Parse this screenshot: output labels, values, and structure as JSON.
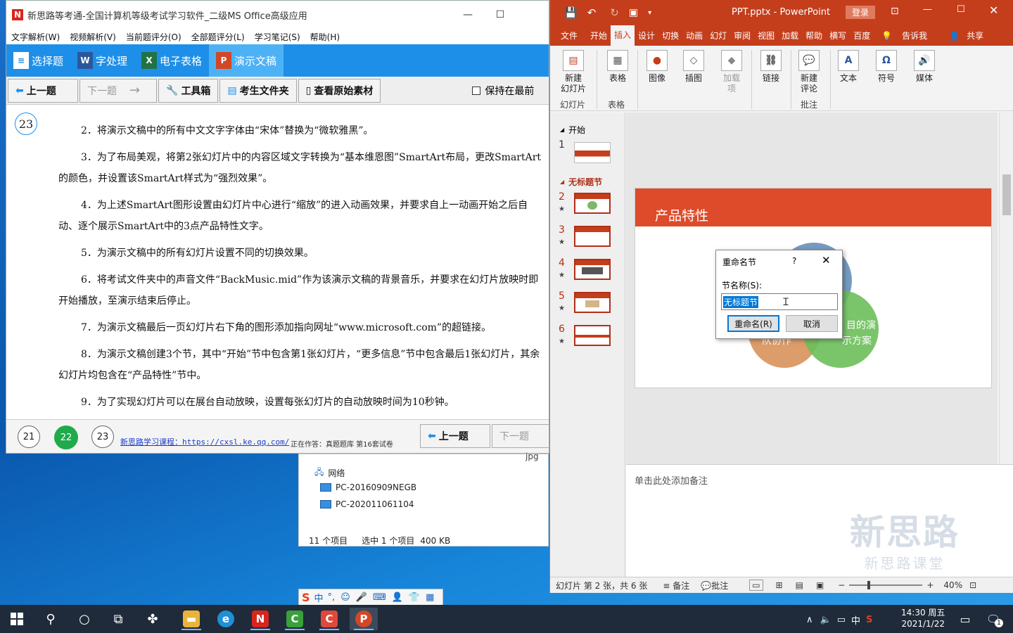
{
  "left_window": {
    "title": "新思路等考通-全国计算机等级考试学习软件_二级MS Office高级应用",
    "menu": [
      "文字解析(W)",
      "视频解析(V)",
      "当前题评分(O)",
      "全部题评分(L)",
      "学习笔记(S)",
      "帮助(H)"
    ],
    "subject_tabs": [
      "选择题",
      "字处理",
      "电子表格",
      "演示文稿"
    ],
    "toolbar": {
      "prev": "上一题",
      "next": "下一题",
      "toolbox": "工具箱",
      "folder": "考生文件夹",
      "original": "查看原始素材",
      "keep": "保持在最前"
    },
    "question_number": "23",
    "items": [
      "2．将演示文稿中的所有中文文字字体由“宋体”替换为“微软雅黑”。",
      "3．为了布局美观，将第2张幻灯片中的内容区域文字转换为“基本维恩图”SmartArt布局，更改SmartArt的颜色，并设置该SmartArt样式为“强烈效果”。",
      "4．为上述SmartArt图形设置由幻灯片中心进行“缩放”的进入动画效果，并要求自上一动画开始之后自动、逐个展示SmartArt中的3点产品特性文字。",
      "5．为演示文稿中的所有幻灯片设置不同的切换效果。",
      "6．将考试文件夹中的声音文件“BackMusic.mid”作为该演示文稿的背景音乐，并要求在幻灯片放映时即开始播放，至演示结束后停止。",
      "7．为演示文稿最后一页幻灯片右下角的图形添加指向网址“www.microsoft.com”的超链接。",
      "8．为演示文稿创建3个节，其中“开始”节中包含第1张幻灯片，“更多信息”节中包含最后1张幻灯片，其余幻灯片均包含在“产品特性”节中。",
      "9．为了实现幻灯片可以在展台自动放映，设置每张幻灯片的自动放映时间为10秒钟。"
    ],
    "footer": {
      "pages": [
        "21",
        "22",
        "23"
      ],
      "link": "新思路学习课程：https://cxsl.ke.qq.com/",
      "status": "正在作答：真题题库 第16套试卷",
      "prev": "上一题",
      "next": "下一题"
    }
  },
  "explorer": {
    "partial_label": "jpg",
    "tree": [
      "网络",
      "PC-20160909NEGB",
      "PC-202011061104"
    ],
    "status_count": "11 个项目",
    "status_selected": "选中 1 个项目",
    "status_size": "400 KB"
  },
  "ppt": {
    "filename": "PPT.pptx",
    "sep": "-",
    "app": "PowerPoint",
    "login": "登录",
    "tabs": [
      "文件",
      "开始",
      "插入",
      "设计",
      "切换",
      "动画",
      "幻灯",
      "审阅",
      "视图",
      "加载",
      "帮助",
      "横写",
      "百度"
    ],
    "tell_me": "告诉我",
    "share": "共享",
    "ribbon": {
      "new_slide": "新建\n幻灯片",
      "table": "表格",
      "image": "图像",
      "illustrations": "插图",
      "addins": "加载\n项",
      "link": "链接",
      "new_comment": "新建\n评论",
      "text": "文本",
      "symbol": "符号",
      "media": "媒体",
      "groups": [
        "幻灯片",
        "表格",
        "批注"
      ]
    },
    "sections": [
      "开始",
      "无标题节"
    ],
    "slide_numbers": [
      "1",
      "2",
      "3",
      "4",
      "5",
      "6"
    ],
    "star": "★",
    "slide_title": "产品特性",
    "venn_fragments": [
      "队协作",
      "目的演",
      "示方案"
    ],
    "notes_placeholder": "单击此处添加备注",
    "status": {
      "slide_info": "幻灯片 第 2 张，共 6 张",
      "notes": "备注",
      "comments": "批注",
      "zoom": "40%"
    },
    "watermark": [
      "新思路",
      "新思路课堂"
    ]
  },
  "dialog": {
    "title": "重命名节",
    "help": "?",
    "label": "节名称(S):",
    "value": "无标题节",
    "ok": "重命名(R)",
    "cancel": "取消"
  },
  "ime": {
    "lang": "中"
  },
  "taskbar": {
    "ime": "中",
    "time": "14:30 周五",
    "date": "2021/1/22",
    "badge": "1"
  }
}
